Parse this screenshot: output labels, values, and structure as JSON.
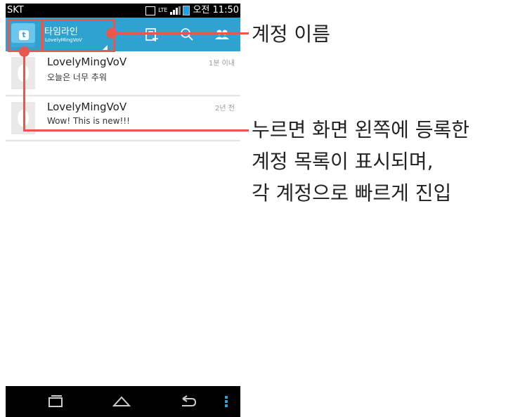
{
  "status_bar": {
    "carrier": "SKT",
    "network": "LTE",
    "time": "오전 11:50"
  },
  "app_bar": {
    "title": "타임라인",
    "account": "LovelyMingVoV"
  },
  "timeline": [
    {
      "name": "LovelyMingVoV",
      "time": "1분 이내",
      "text": "오늘은 너무 추워"
    },
    {
      "name": "LovelyMingVoV",
      "time": "2년 전",
      "text": "Wow! This is new!!!"
    }
  ],
  "annotations": {
    "account_name": "계정 이름",
    "press_lines": [
      "누르면 화면 왼쪽에 등록한",
      "계정 목록이 표시되며,",
      "각 계정으로 빠르게 진입"
    ]
  },
  "colors": {
    "accent": "#2ea3cf",
    "callout": "#e8574f"
  }
}
